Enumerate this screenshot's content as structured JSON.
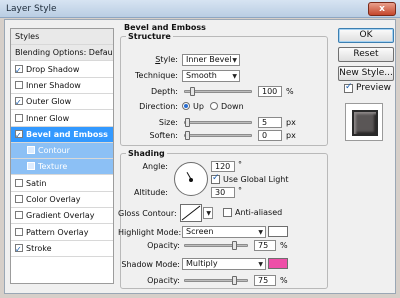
{
  "window": {
    "title": "Layer Style",
    "close_symbol": "x"
  },
  "left_list": [
    {
      "label": "Styles",
      "checkbox": null,
      "state": "header"
    },
    {
      "label": "Blending Options: Default",
      "checkbox": null,
      "state": "header"
    },
    {
      "label": "Drop Shadow",
      "checkbox": true,
      "state": "normal"
    },
    {
      "label": "Inner Shadow",
      "checkbox": false,
      "state": "normal"
    },
    {
      "label": "Outer Glow",
      "checkbox": true,
      "state": "normal"
    },
    {
      "label": "Inner Glow",
      "checkbox": false,
      "state": "normal"
    },
    {
      "label": "Bevel and Emboss",
      "checkbox": true,
      "state": "selected"
    },
    {
      "label": "Contour",
      "checkbox": false,
      "state": "sub"
    },
    {
      "label": "Texture",
      "checkbox": false,
      "state": "sub"
    },
    {
      "label": "Satin",
      "checkbox": false,
      "state": "normal"
    },
    {
      "label": "Color Overlay",
      "checkbox": false,
      "state": "normal"
    },
    {
      "label": "Gradient Overlay",
      "checkbox": false,
      "state": "normal"
    },
    {
      "label": "Pattern Overlay",
      "checkbox": false,
      "state": "normal"
    },
    {
      "label": "Stroke",
      "checkbox": true,
      "state": "normal"
    }
  ],
  "bevel": {
    "section_title": "Bevel and Emboss",
    "structure_title": "Structure",
    "style_label": "Style:",
    "style_value": "Inner Bevel",
    "technique_label": "Technique:",
    "technique_value": "Smooth",
    "depth_label": "Depth:",
    "depth_value": "100",
    "depth_unit": "%",
    "depth_fraction": 0.1,
    "direction_label": "Direction:",
    "direction_up": "Up",
    "direction_down": "Down",
    "size_label": "Size:",
    "size_value": "5",
    "size_unit": "px",
    "soften_label": "Soften:",
    "soften_value": "0",
    "soften_unit": "px"
  },
  "shading": {
    "title": "Shading",
    "angle_label": "Angle:",
    "angle_value": "120",
    "angle_unit": "°",
    "global_light_label": "Use Global Light",
    "global_light_checked": true,
    "altitude_label": "Altitude:",
    "altitude_value": "30",
    "altitude_unit": "°",
    "gloss_label": "Gloss Contour:",
    "antialiased_label": "Anti-aliased",
    "antialiased_checked": false,
    "highlight_mode_label": "Highlight Mode:",
    "highlight_mode_value": "Screen",
    "highlight_color": "#ffffff",
    "highlight_opacity_label": "Opacity:",
    "highlight_opacity_value": "75",
    "highlight_opacity_unit": "%",
    "shadow_mode_label": "Shadow Mode:",
    "shadow_mode_value": "Multiply",
    "shadow_color": "#ee4fa8",
    "shadow_opacity_label": "Opacity:",
    "shadow_opacity_value": "75",
    "shadow_opacity_unit": "%"
  },
  "buttons": {
    "ok": "OK",
    "reset": "Reset",
    "new_style": "New Style...",
    "preview_label": "Preview",
    "preview_checked": true
  }
}
